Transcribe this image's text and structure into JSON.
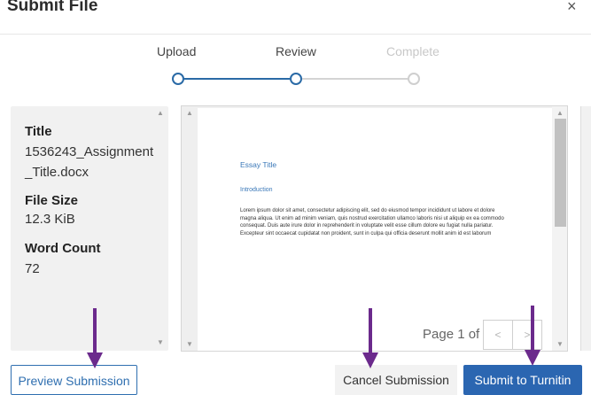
{
  "dialog": {
    "title": "Submit File",
    "close_glyph": "×"
  },
  "stepper": {
    "steps": [
      {
        "label": "Upload",
        "state": "done"
      },
      {
        "label": "Review",
        "state": "current"
      },
      {
        "label": "Complete",
        "state": "pending"
      }
    ]
  },
  "details": {
    "title_label": "Title",
    "title_value": "1536243_Assignment_Title.docx",
    "size_label": "File Size",
    "size_value": "12.3 KiB",
    "count_label": "Word Count",
    "count_value": "72"
  },
  "preview": {
    "doc_title": "Essay Title",
    "doc_heading": "Introduction",
    "doc_body": "Lorem ipsum dolor sit amet, consectetur adipiscing elit, sed do eiusmod tempor incididunt ut labore et dolore magna aliqua. Ut enim ad minim veniam, quis nostrud exercitation ullamco laboris nisi ut aliquip ex ea commodo consequat. Duis aute irure dolor in reprehenderit in voluptate velit esse cillum dolore eu fugiat nulla pariatur. Excepteur sint occaecat cupidatat non proident, sunt in culpa qui officia deserunt mollit anim id est laborum",
    "pager_label": "Page 1 of 1",
    "prev_glyph": "<",
    "next_glyph": ">"
  },
  "footer": {
    "preview_label": "Preview Submission",
    "cancel_label": "Cancel Submission",
    "submit_label": "Submit to Turnitin"
  },
  "colors": {
    "accent": "#2b66b1",
    "annotation_arrow": "#6b2a8c",
    "step_active": "#2a6aa6",
    "step_inactive": "#cfcfcf"
  }
}
